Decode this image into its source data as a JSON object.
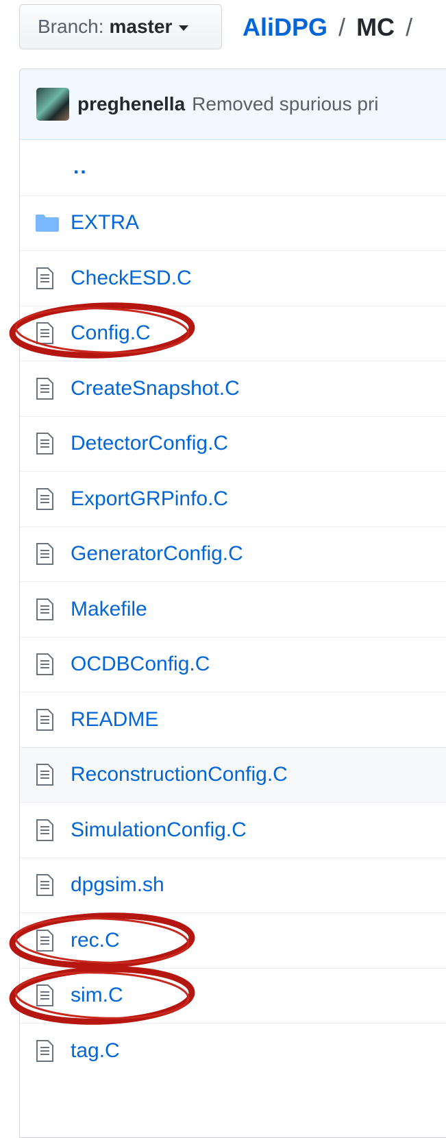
{
  "header": {
    "branch_label": "Branch:",
    "branch_name": "master",
    "repo": "AliDPG",
    "sep1": "/",
    "dir": "MC",
    "sep2": "/"
  },
  "commit": {
    "author": "preghenella",
    "message": "Removed spurious pri"
  },
  "files": {
    "parent": "..",
    "extra": "EXTRA",
    "checkesd": "CheckESD.C",
    "config": "Config.C",
    "createsnapshot": "CreateSnapshot.C",
    "detectorconfig": "DetectorConfig.C",
    "exportgrpinfo": "ExportGRPinfo.C",
    "generatorconfig": "GeneratorConfig.C",
    "makefile": "Makefile",
    "ocdbconfig": "OCDBConfig.C",
    "readme": "README",
    "reconstructionconfig": "ReconstructionConfig.C",
    "simulationconfig": "SimulationConfig.C",
    "dpgsim": "dpgsim.sh",
    "rec": "rec.C",
    "sim": "sim.C",
    "tag": "tag.C"
  },
  "icons": {
    "folder": "folder-icon",
    "file": "file-icon"
  },
  "colors": {
    "link": "#0366d6",
    "folder": "#79b8ff",
    "annotation_circle": "#b5160f",
    "commit_bg": "#f1f8ff"
  }
}
